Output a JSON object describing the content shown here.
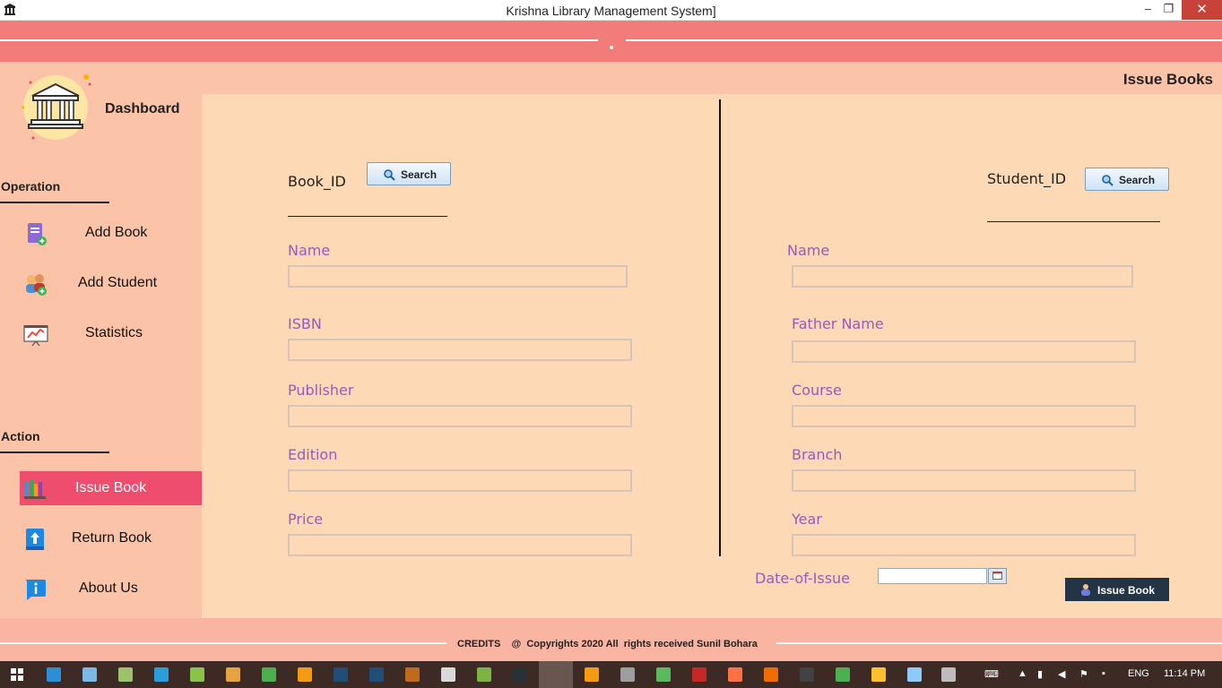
{
  "window": {
    "title": "Krishna Library Management System]",
    "minimize": "–",
    "maximize": "❐",
    "close": "✕"
  },
  "page_title": "Issue Books",
  "sidebar": {
    "dashboard": "Dashboard",
    "operation_title": "Operation",
    "operation_items": [
      {
        "label": "Add Book",
        "icon": "add-book-icon"
      },
      {
        "label": "Add Student",
        "icon": "add-student-icon"
      },
      {
        "label": "Statistics",
        "icon": "statistics-icon"
      }
    ],
    "action_title": "Action",
    "action_items": [
      {
        "label": "Issue Book",
        "icon": "issue-book-icon",
        "active": true
      },
      {
        "label": "Return Book",
        "icon": "return-book-icon"
      },
      {
        "label": "About Us",
        "icon": "info-icon"
      }
    ]
  },
  "book": {
    "id_label": "Book_ID",
    "search": "Search",
    "fields": [
      {
        "label": "Name",
        "value": ""
      },
      {
        "label": "ISBN",
        "value": ""
      },
      {
        "label": "Publisher",
        "value": ""
      },
      {
        "label": "Edition",
        "value": ""
      },
      {
        "label": "Price",
        "value": ""
      }
    ]
  },
  "student": {
    "id_label": "Student_ID",
    "search": "Search",
    "fields": [
      {
        "label": "Name",
        "value": ""
      },
      {
        "label": "Father Name",
        "value": ""
      },
      {
        "label": "Course",
        "value": ""
      },
      {
        "label": "Branch",
        "value": ""
      },
      {
        "label": "Year",
        "value": ""
      }
    ]
  },
  "issue": {
    "date_label": "Date-of-Issue",
    "date_value": "",
    "button": "Issue Book"
  },
  "footer": {
    "credits": "CREDITS    @  Copyrights 2020 All  rights received Sunil Bohara"
  },
  "taskbar": {
    "language": "ENG",
    "time": "11:14 PM"
  },
  "colors": {
    "header": "#f27c7a",
    "sidebar": "#fbc3a8",
    "main": "#fdd9b6",
    "active_item": "#ef4d6d",
    "field_label": "#9b59b6",
    "footer": "#fab4a2",
    "taskbar": "#3e2a25"
  }
}
